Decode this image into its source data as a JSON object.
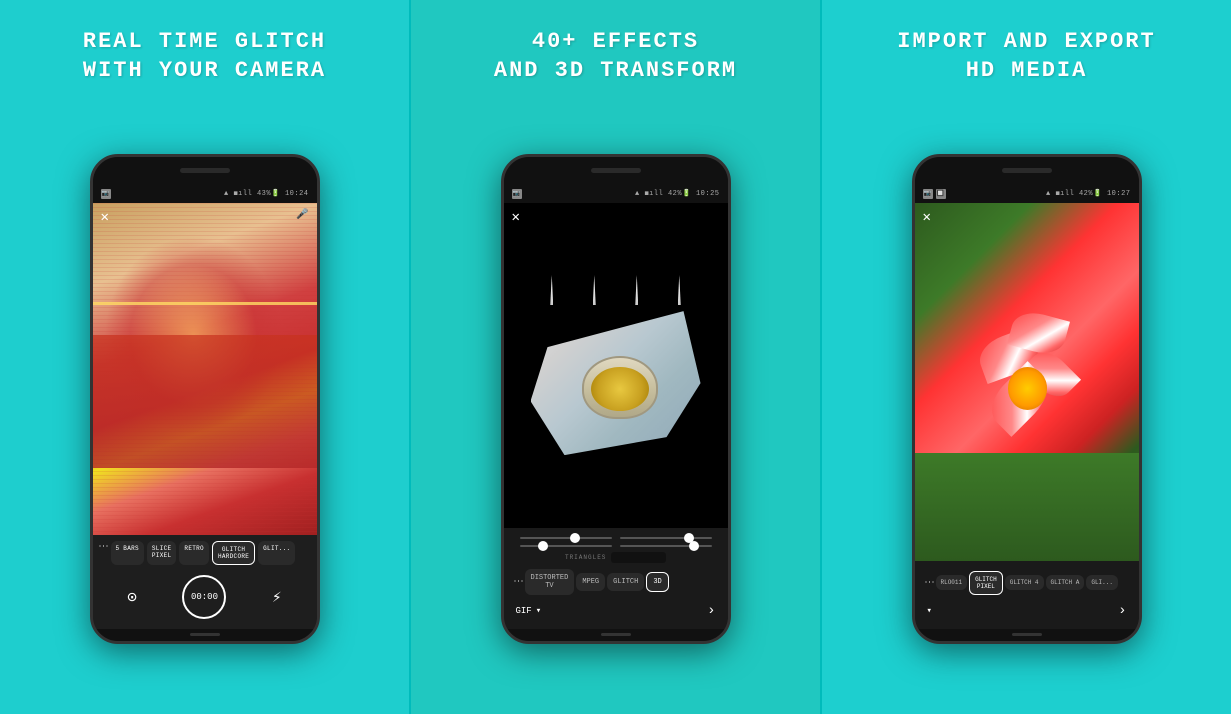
{
  "panels": [
    {
      "id": "left",
      "title": "REAL TIME GLITCH\nWITH YOUR CAMERA",
      "phone": {
        "status_left": "📷",
        "status_right": "▲ ◼.ıll 43% 🔋 10:24",
        "effects": [
          {
            "label": "5 BARS",
            "active": false
          },
          {
            "label": "SLICE\nPIXEL",
            "active": false
          },
          {
            "label": "RETRO",
            "active": false
          },
          {
            "label": "GLITCH\nHARDCORE",
            "active": true
          },
          {
            "label": "GLIT...",
            "active": false
          }
        ],
        "timer": "00:00"
      }
    },
    {
      "id": "center",
      "title": "40+ EFFECTS\nAND 3D TRANSFORM",
      "phone": {
        "status_right": "▲ ◼.ıll 42% 🔋 10:25",
        "effects": [
          {
            "label": "DISTORTED\nTV",
            "active": false
          },
          {
            "label": "MPEG",
            "active": false
          },
          {
            "label": "GLITCH",
            "active": false
          },
          {
            "label": "3D",
            "active": true
          }
        ],
        "triangles_label": "TRIANGLES",
        "export_label": "GIF"
      }
    },
    {
      "id": "right",
      "title": "IMPORT AND EXPORT\nHD MEDIA",
      "phone": {
        "status_right": "▲ ◼.ıll 42% 🔋 10:27",
        "effects": [
          {
            "label": "RLO011",
            "active": false
          },
          {
            "label": "GLITCH\nPIXEL",
            "active": true
          },
          {
            "label": "GLITCH 4",
            "active": false
          },
          {
            "label": "GLITCH A",
            "active": false
          },
          {
            "label": "GLI...",
            "active": false
          }
        ],
        "export_label": "▼"
      }
    }
  ],
  "icons": {
    "close": "✕",
    "mic": "🎤",
    "dots": "⋮",
    "camera": "⊙",
    "flash": "⚡",
    "arrow_right": "›",
    "chevron_down": "▾"
  }
}
